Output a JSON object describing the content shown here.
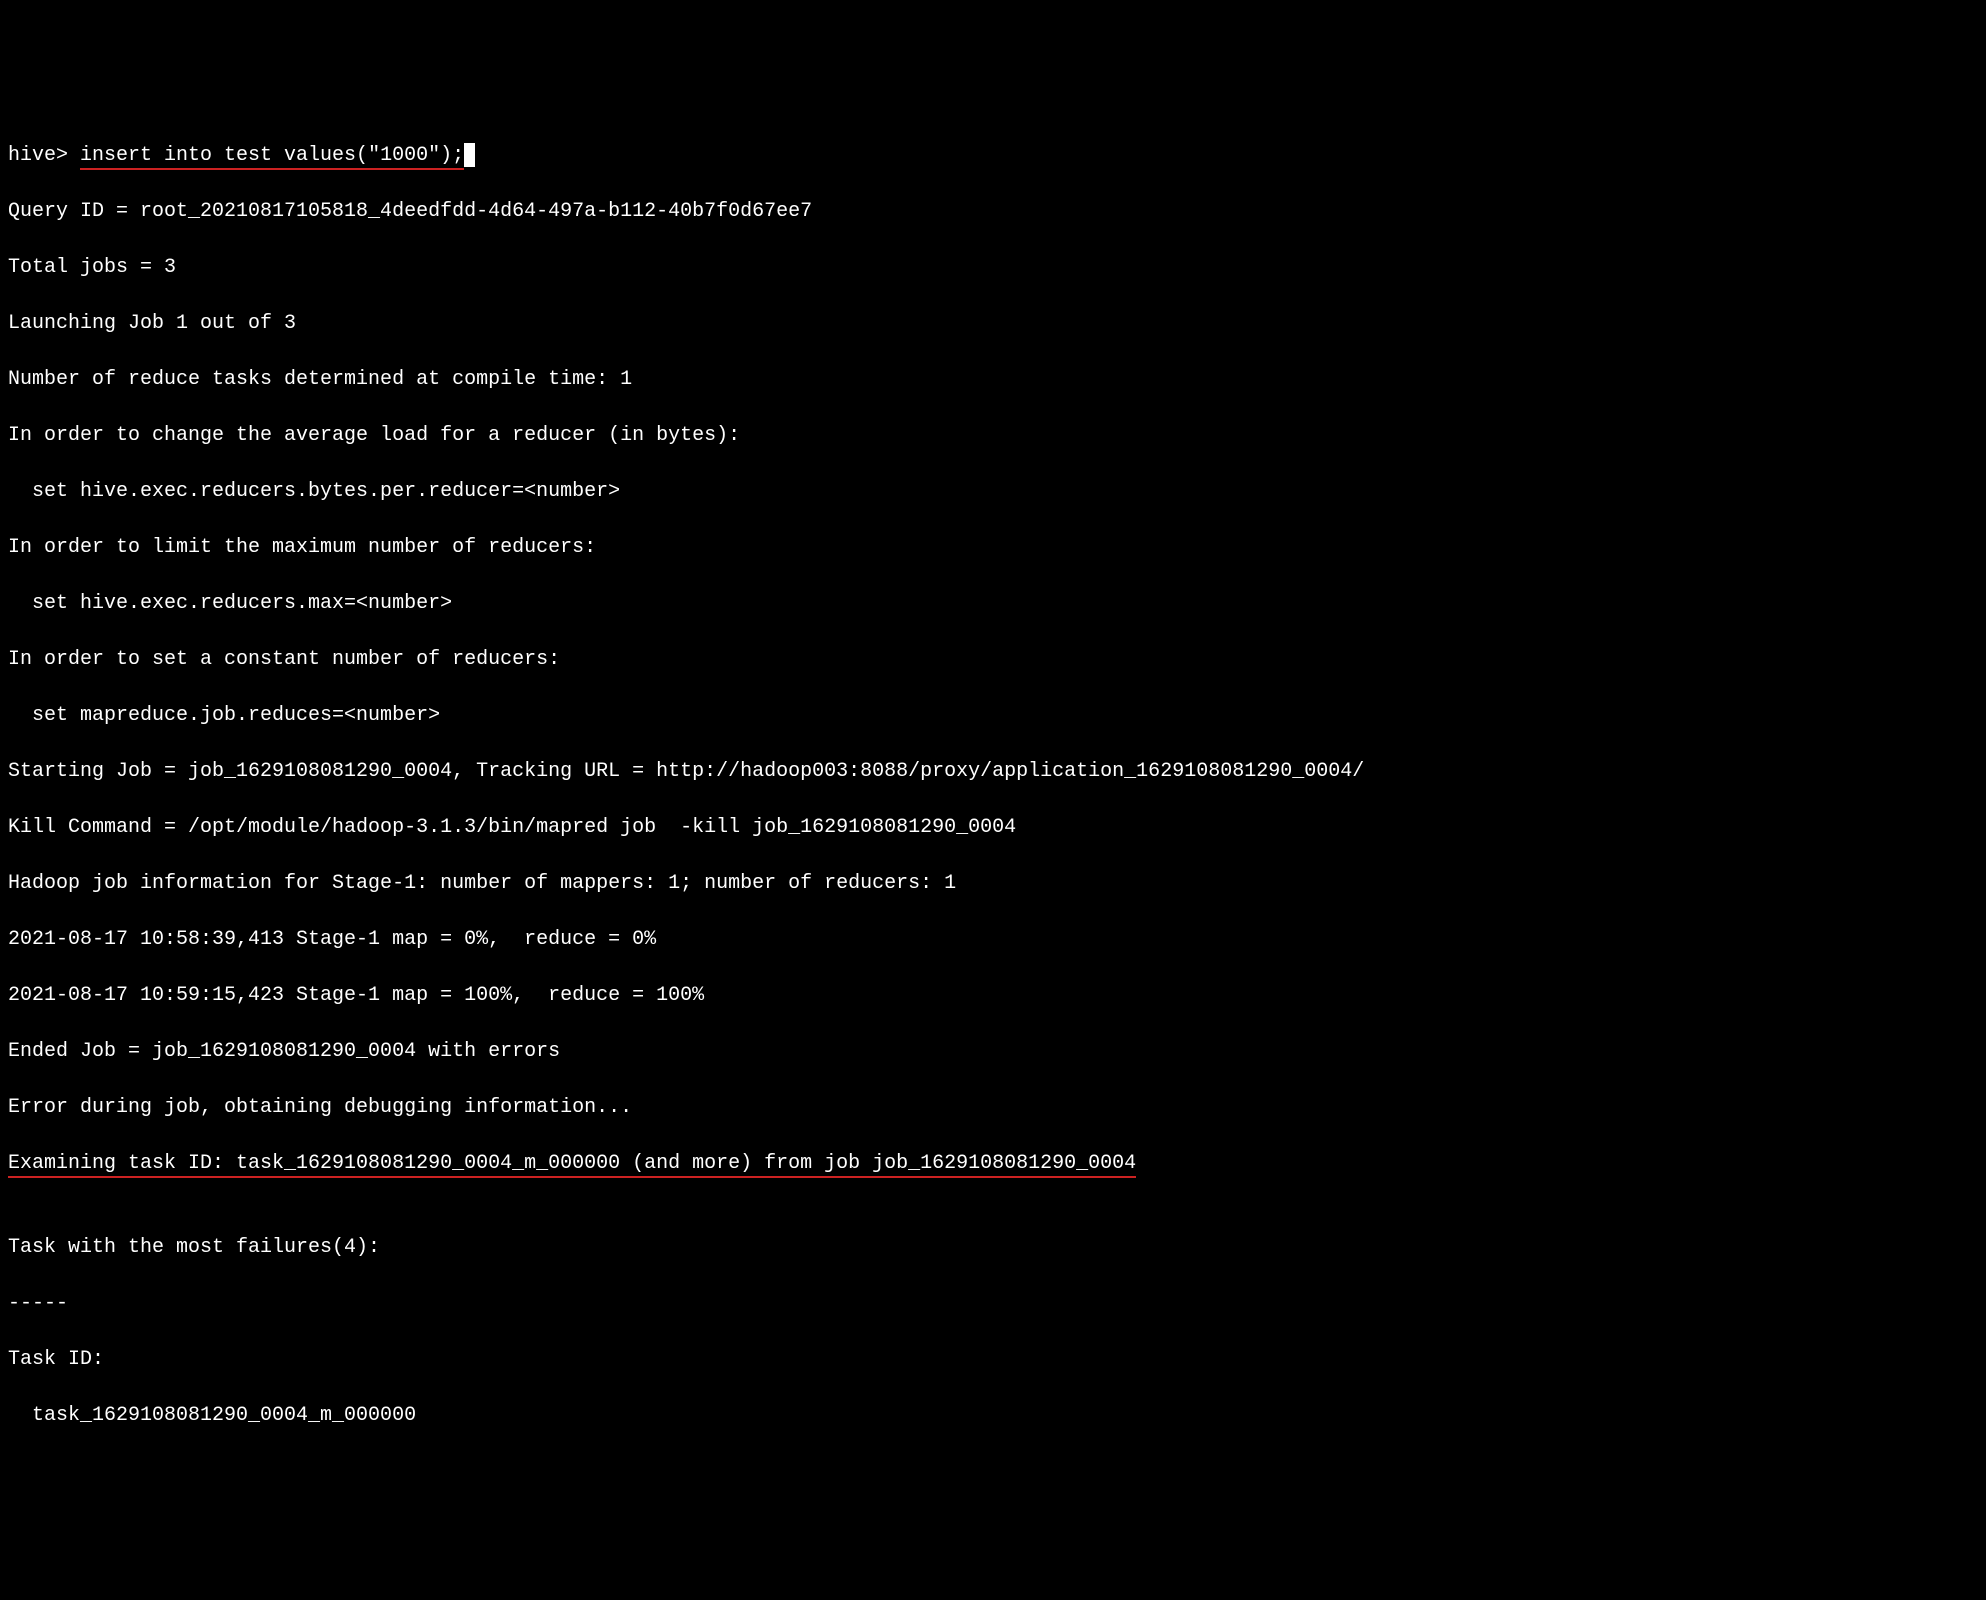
{
  "terminal": {
    "prompt": "hive> ",
    "command": "insert into test values(\"1000\");",
    "lines": {
      "queryId": "Query ID = root_20210817105818_4deedfdd-4d64-497a-b112-40b7f0d67ee7",
      "totalJobs": "Total jobs = 3",
      "launching": "Launching Job 1 out of 3",
      "reduceTasks": "Number of reduce tasks determined at compile time: 1",
      "changeLoad": "In order to change the average load for a reducer (in bytes):",
      "setBytes": "  set hive.exec.reducers.bytes.per.reducer=<number>",
      "limitMax": "In order to limit the maximum number of reducers:",
      "setMax": "  set hive.exec.reducers.max=<number>",
      "setConstant": "In order to set a constant number of reducers:",
      "setReduces": "  set mapreduce.job.reduces=<number>",
      "startingJob": "Starting Job = job_1629108081290_0004, Tracking URL = http://hadoop003:8088/proxy/application_1629108081290_0004/",
      "killCommand": "Kill Command = /opt/module/hadoop-3.1.3/bin/mapred job  -kill job_1629108081290_0004",
      "hadoopInfo": "Hadoop job information for Stage-1: number of mappers: 1; number of reducers: 1",
      "progress1": "2021-08-17 10:58:39,413 Stage-1 map = 0%,  reduce = 0%",
      "progress2": "2021-08-17 10:59:15,423 Stage-1 map = 100%,  reduce = 100%",
      "endedJob": "Ended Job = job_1629108081290_0004 with errors",
      "errorDuring": "Error during job, obtaining debugging information...",
      "examining": "Examining task ID: task_1629108081290_0004_m_000000 (and more) from job job_1629108081290_0004",
      "blank1": "",
      "taskFailures": "Task with the most failures(4):",
      "dashes": "-----",
      "taskIdLabel": "Task ID:",
      "taskIdValue": "  task_1629108081290_0004_m_000000"
    }
  }
}
